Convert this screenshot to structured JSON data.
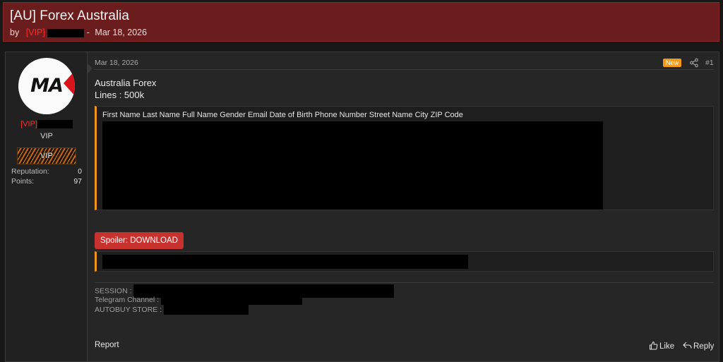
{
  "thread": {
    "title": "[AU] Forex Australia",
    "by_label": "by",
    "author_tag": "[VIP]",
    "separator": "-",
    "date": "Mar 18, 2026"
  },
  "user": {
    "avatar_text": "MA",
    "tag": "[VIP]",
    "title": "VIP",
    "banner_text": "VIP",
    "stats": [
      {
        "label": "Reputation:",
        "value": "0"
      },
      {
        "label": "Points:",
        "value": "97"
      }
    ]
  },
  "post": {
    "date": "Mar 18, 2026",
    "badge": "New",
    "number": "#1",
    "lines": [
      "Australia Forex",
      "Lines : 500k"
    ],
    "quote_header": "First Name Last Name Full Name Gender Email Date of Birth Phone Number Street Name City ZIP Code",
    "spoiler_label": "Spoiler: DOWNLOAD",
    "signature": [
      "SESSION :",
      "Telegram Channel :",
      "AUTOBUY STORE :"
    ]
  },
  "actions": {
    "report": "Report",
    "like": "Like",
    "reply": "Reply"
  },
  "colors": {
    "header_bg": "#6b1c1c",
    "vip_red": "#ff2b2b",
    "accent_orange": "#f0951c",
    "spoiler_red": "#c7312e",
    "badge_orange": "#f39a1a"
  },
  "icons": [
    "share-icon",
    "thumbs-up-icon",
    "reply-icon"
  ]
}
